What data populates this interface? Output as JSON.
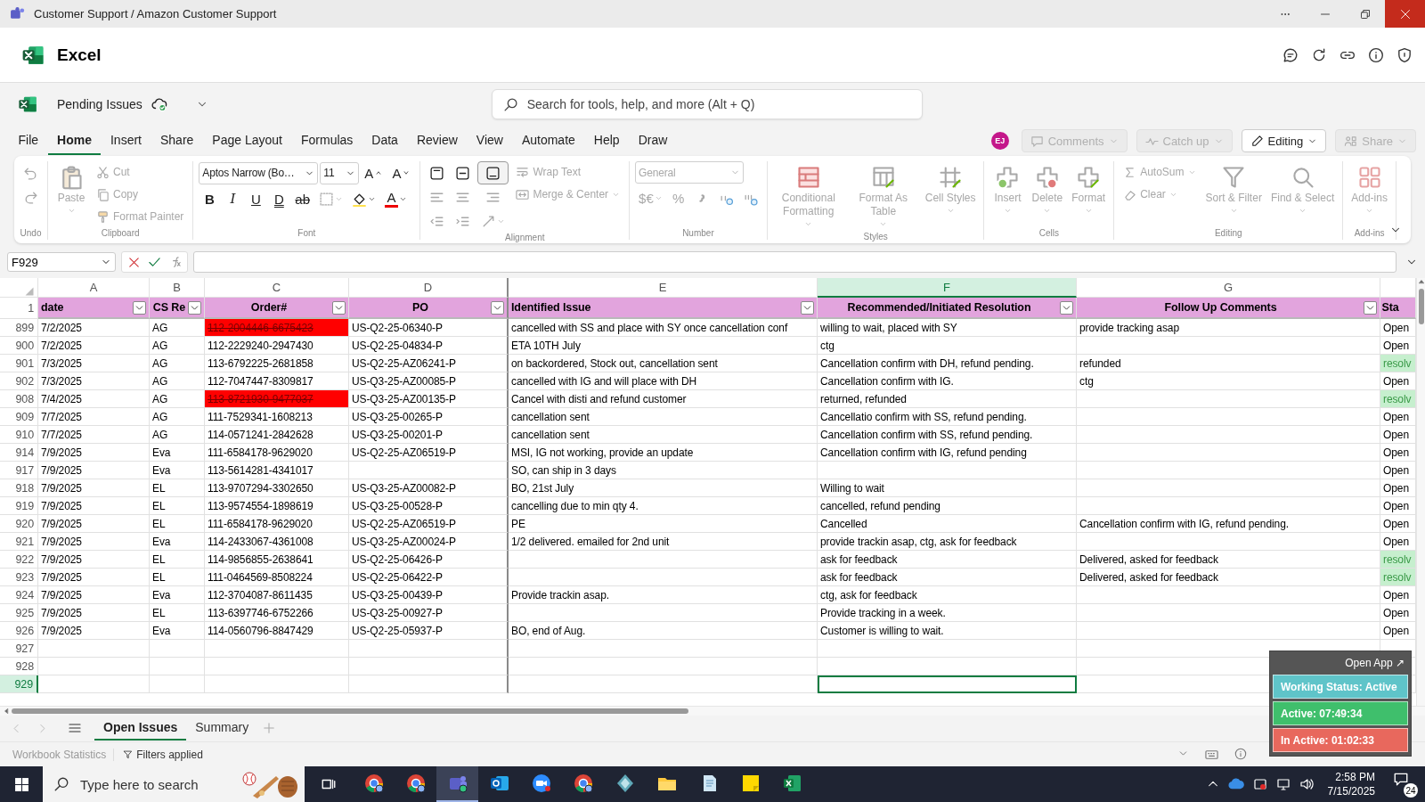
{
  "window": {
    "title": "Customer Support / Amazon Customer Support"
  },
  "app": {
    "name": "Excel"
  },
  "document": {
    "name": "Pending Issues"
  },
  "search": {
    "placeholder": "Search for tools, help, and more (Alt + Q)"
  },
  "menu_tabs": [
    {
      "label": "File",
      "selected": false
    },
    {
      "label": "Home",
      "selected": true
    },
    {
      "label": "Insert",
      "selected": false
    },
    {
      "label": "Share",
      "selected": false
    },
    {
      "label": "Page Layout",
      "selected": false
    },
    {
      "label": "Formulas",
      "selected": false
    },
    {
      "label": "Data",
      "selected": false
    },
    {
      "label": "Review",
      "selected": false
    },
    {
      "label": "View",
      "selected": false
    },
    {
      "label": "Automate",
      "selected": false
    },
    {
      "label": "Help",
      "selected": false
    },
    {
      "label": "Draw",
      "selected": false
    }
  ],
  "user": {
    "initials": "EJ"
  },
  "actions": [
    {
      "label": "Comments",
      "disabled": true
    },
    {
      "label": "Catch up",
      "disabled": true
    },
    {
      "label": "Editing",
      "disabled": false
    },
    {
      "label": "Share",
      "disabled": true
    }
  ],
  "ribbon": {
    "groups": [
      {
        "label": "Undo",
        "columns": [
          [
            {
              "kind": "tool",
              "disabled": true
            },
            {
              "kind": "tool",
              "disabled": true
            }
          ]
        ]
      },
      {
        "label": "Clipboard",
        "columns": [
          [
            {
              "kind": "large",
              "label": "Paste",
              "disabled": true,
              "dropdown": true
            }
          ],
          [
            {
              "kind": "small",
              "label": "Cut",
              "disabled": true
            },
            {
              "kind": "small",
              "label": "Copy",
              "disabled": true
            },
            {
              "kind": "small",
              "label": "Format Painter",
              "disabled": true
            }
          ]
        ]
      },
      {
        "label": "Font",
        "lines": [
          [
            {
              "kind": "select",
              "value": "Aptos Narrow (Bo…",
              "disabled": false
            },
            {
              "kind": "select",
              "value": "11",
              "disabled": false
            },
            {
              "kind": "tool",
              "label": "A",
              "disabled": false
            },
            {
              "kind": "tool",
              "label": "A",
              "disabled": false
            }
          ],
          [
            {
              "kind": "tool",
              "label": "B",
              "disabled": false
            },
            {
              "kind": "tool",
              "label": "I",
              "disabled": false
            },
            {
              "kind": "tool",
              "label": "U",
              "disabled": false
            },
            {
              "kind": "tool",
              "label": "D",
              "disabled": false
            },
            {
              "kind": "tool",
              "label": "ab",
              "disabled": false
            },
            {
              "kind": "tool",
              "disabled": true,
              "dropdown": true
            },
            {
              "kind": "tool",
              "disabled": false,
              "dropdown": true
            },
            {
              "kind": "tool",
              "label": "A",
              "disabled": false,
              "dropdown": true
            }
          ]
        ]
      },
      {
        "label": "Alignment",
        "columns": [
          [
            {
              "kind": "tool",
              "disabled": false,
              "selected": false
            },
            {
              "kind": "tool",
              "disabled": true
            },
            {
              "kind": "tool",
              "disabled": true
            }
          ],
          [
            {
              "kind": "tool",
              "disabled": false,
              "selected": false
            },
            {
              "kind": "tool",
              "disabled": true
            },
            {
              "kind": "tool",
              "disabled": true
            }
          ],
          [
            {
              "kind": "tool",
              "disabled": false,
              "selected": true
            },
            {
              "kind": "tool",
              "disabled": true
            },
            {
              "kind": "tool",
              "disabled": true,
              "dropdown": true
            }
          ],
          [
            {
              "kind": "small",
              "label": "Wrap Text",
              "disabled": true
            },
            {
              "kind": "small",
              "label": "Merge & Center",
              "disabled": true,
              "dropdown": true
            }
          ]
        ]
      },
      {
        "label": "Number",
        "lines": [
          [
            {
              "kind": "select",
              "value": "General",
              "disabled": true
            }
          ],
          [
            {
              "kind": "tool",
              "label": "$€",
              "disabled": true,
              "dropdown": true
            },
            {
              "kind": "tool",
              "label": "%",
              "disabled": true
            },
            {
              "kind": "tool",
              "disabled": true
            },
            {
              "kind": "tool",
              "disabled": true
            },
            {
              "kind": "tool",
              "disabled": true
            }
          ]
        ]
      },
      {
        "label": "Styles",
        "columns": [
          [
            {
              "kind": "large",
              "label": "Conditional Formatting",
              "disabled": true,
              "dropdown": true
            }
          ],
          [
            {
              "kind": "large",
              "label": "Format As Table",
              "disabled": true,
              "dropdown": true
            }
          ],
          [
            {
              "kind": "large",
              "label": "Cell Styles",
              "disabled": true,
              "dropdown": true
            }
          ]
        ]
      },
      {
        "label": "Cells",
        "columns": [
          [
            {
              "kind": "large",
              "label": "Insert",
              "disabled": true,
              "dropdown": true
            }
          ],
          [
            {
              "kind": "large",
              "label": "Delete",
              "disabled": true,
              "dropdown": true
            }
          ],
          [
            {
              "kind": "large",
              "label": "Format",
              "disabled": true,
              "dropdown": true
            }
          ]
        ]
      },
      {
        "label": "Editing",
        "columns": [
          [
            {
              "kind": "small",
              "label": "AutoSum",
              "disabled": true,
              "dropdown": true
            },
            {
              "kind": "small",
              "label": "Clear",
              "disabled": true,
              "dropdown": true
            }
          ],
          [
            {
              "kind": "large",
              "label": "Sort & Filter",
              "disabled": true,
              "dropdown": true
            }
          ],
          [
            {
              "kind": "large",
              "label": "Find & Select",
              "disabled": true,
              "dropdown": true
            }
          ]
        ]
      },
      {
        "label": "Add-ins",
        "columns": [
          [
            {
              "kind": "large",
              "label": "Add-ins",
              "disabled": true,
              "dropdown": true
            }
          ]
        ]
      }
    ]
  },
  "formula_bar": {
    "name_box": "F929"
  },
  "sheet": {
    "columns": [
      {
        "letter": "A",
        "selected": false
      },
      {
        "letter": "B",
        "selected": false
      },
      {
        "letter": "C",
        "selected": false
      },
      {
        "letter": "D",
        "selected": false
      },
      {
        "letter": "E",
        "selected": false
      },
      {
        "letter": "F",
        "selected": true
      },
      {
        "letter": "G",
        "selected": false
      }
    ],
    "header_row": "1",
    "headers": [
      "date",
      "CS Re",
      "Order#",
      "PO",
      "Identified Issue",
      "Recommended/Initiated Resolution",
      "Follow Up Comments",
      "Sta"
    ],
    "rows": [
      {
        "row": "899",
        "selected": false,
        "date": "7/2/2025",
        "cs_rep": "AG",
        "order": "112-2004446-6675423",
        "order_flagged": true,
        "po": "US-Q2-25-06340-P",
        "issue": "cancelled with SS and place with SY once cancellation conf",
        "resolution": "willing to wait, placed with SY",
        "follow_up": "provide tracking asap",
        "status": "Open",
        "resolved": false
      },
      {
        "row": "900",
        "selected": false,
        "date": "7/2/2025",
        "cs_rep": "AG",
        "order": "112-2229240-2947430",
        "order_flagged": false,
        "po": "US-Q2-25-04834-P",
        "issue": "ETA 10TH July",
        "resolution": "ctg",
        "status": "Open",
        "resolved": false
      },
      {
        "row": "901",
        "selected": false,
        "date": "7/3/2025",
        "cs_rep": "AG",
        "order": "113-6792225-2681858",
        "order_flagged": false,
        "po": "US-Q2-25-AZ06241-P",
        "issue": "on backordered, Stock out, cancellation sent",
        "resolution": "Cancellation confirm with DH, refund pending.",
        "follow_up": "refunded",
        "status": "resolv",
        "resolved": true
      },
      {
        "row": "902",
        "selected": false,
        "date": "7/3/2025",
        "cs_rep": "AG",
        "order": "112-7047447-8309817",
        "order_flagged": false,
        "po": "US-Q3-25-AZ00085-P",
        "issue": "cancelled with IG and will place with DH",
        "resolution": "Cancellation confirm with IG.",
        "follow_up": "ctg",
        "status": "Open",
        "resolved": false
      },
      {
        "row": "908",
        "selected": false,
        "date": "7/4/2025",
        "cs_rep": "AG",
        "order": "113-8721930-9477037",
        "order_flagged": true,
        "po": "US-Q3-25-AZ00135-P",
        "issue": "Cancel with disti and refund customer",
        "resolution": "returned, refunded",
        "status": "resolv",
        "resolved": true
      },
      {
        "row": "909",
        "selected": false,
        "date": "7/7/2025",
        "cs_rep": "AG",
        "order": "111-7529341-1608213",
        "order_flagged": false,
        "po": "US-Q3-25-00265-P",
        "issue": "cancellation sent",
        "resolution": "Cancellatio confirm with SS, refund pending.",
        "status": "Open",
        "resolved": false
      },
      {
        "row": "910",
        "selected": false,
        "date": "7/7/2025",
        "cs_rep": "AG",
        "order": "114-0571241-2842628",
        "order_flagged": false,
        "po": "US-Q3-25-00201-P",
        "issue": "cancellation sent",
        "resolution": "Cancellation confirm with SS, refund pending.",
        "status": "Open",
        "resolved": false
      },
      {
        "row": "914",
        "selected": false,
        "date": "7/9/2025",
        "cs_rep": "Eva",
        "order": "111-6584178-9629020",
        "order_flagged": false,
        "po": "US-Q2-25-AZ06519-P",
        "issue": "MSI, IG not working, provide an update",
        "resolution": "Cancellation confirm with IG, refund pending",
        "status": "Open",
        "resolved": false
      },
      {
        "row": "917",
        "selected": false,
        "date": "7/9/2025",
        "cs_rep": "Eva",
        "order": "113-5614281-4341017",
        "order_flagged": false,
        "issue": "SO, can ship in 3 days",
        "status": "Open",
        "resolved": false
      },
      {
        "row": "918",
        "selected": false,
        "date": "7/9/2025",
        "cs_rep": "EL",
        "order": "113-9707294-3302650",
        "order_flagged": false,
        "po": "US-Q3-25-AZ00082-P",
        "issue": "BO, 21st July",
        "resolution": "Willing to wait",
        "status": "Open",
        "resolved": false
      },
      {
        "row": "919",
        "selected": false,
        "date": "7/9/2025",
        "cs_rep": "EL",
        "order": "113-9574554-1898619",
        "order_flagged": false,
        "po": "US-Q3-25-00528-P",
        "issue": "cancelling due to min qty 4.",
        "resolution": "cancelled, refund pending",
        "status": "Open",
        "resolved": false
      },
      {
        "row": "920",
        "selected": false,
        "date": "7/9/2025",
        "cs_rep": "EL",
        "order": "111-6584178-9629020",
        "order_flagged": false,
        "po": "US-Q2-25-AZ06519-P",
        "issue": "PE",
        "resolution": "Cancelled",
        "follow_up": "Cancellation confirm with IG, refund pending.",
        "status": "Open",
        "resolved": false
      },
      {
        "row": "921",
        "selected": false,
        "date": "7/9/2025",
        "cs_rep": "Eva",
        "order": "114-2433067-4361008",
        "order_flagged": false,
        "po": "US-Q3-25-AZ00024-P",
        "issue": "1/2 delivered. emailed for 2nd unit",
        "resolution": "provide trackin asap, ctg, ask for feedback",
        "status": "Open",
        "resolved": false
      },
      {
        "row": "922",
        "selected": false,
        "date": "7/9/2025",
        "cs_rep": "EL",
        "order": "114-9856855-2638641",
        "order_flagged": false,
        "po": "US-Q2-25-06426-P",
        "resolution": "ask for feedback",
        "follow_up": "Delivered, asked for feedback",
        "status": "resolv",
        "resolved": true
      },
      {
        "row": "923",
        "selected": false,
        "date": "7/9/2025",
        "cs_rep": "EL",
        "order": "111-0464569-8508224",
        "order_flagged": false,
        "po": "US-Q2-25-06422-P",
        "resolution": "ask for feedback",
        "follow_up": "Delivered, asked for feedback",
        "status": "resolv",
        "resolved": true
      },
      {
        "row": "924",
        "selected": false,
        "date": "7/9/2025",
        "cs_rep": "Eva",
        "order": "112-3704087-8611435",
        "order_flagged": false,
        "po": "US-Q3-25-00439-P",
        "issue": "Provide trackin asap.",
        "resolution": "ctg, ask for feedback",
        "status": "Open",
        "resolved": false
      },
      {
        "row": "925",
        "selected": false,
        "date": "7/9/2025",
        "cs_rep": "EL",
        "order": "113-6397746-6752266",
        "order_flagged": false,
        "po": "US-Q3-25-00927-P",
        "resolution": "Provide tracking in a week.",
        "status": "Open",
        "resolved": false
      },
      {
        "row": "926",
        "selected": false,
        "date": "7/9/2025",
        "cs_rep": "Eva",
        "order": "114-0560796-8847429",
        "order_flagged": false,
        "po": "US-Q2-25-05937-P",
        "issue": "BO, end of Aug.",
        "resolution": "Customer is willing to wait.",
        "status": "Open",
        "resolved": false
      },
      {
        "row": "927",
        "selected": false
      },
      {
        "row": "928",
        "selected": false
      },
      {
        "row": "929",
        "selected": true
      }
    ]
  },
  "sheet_tabs": [
    {
      "label": "Open Issues",
      "selected": true
    },
    {
      "label": "Summary",
      "selected": false
    }
  ],
  "status_bar": [
    {
      "label": "Workbook Statistics",
      "disabled": true
    },
    {
      "label": "Filters applied",
      "disabled": false
    }
  ],
  "tracker": {
    "link": "Open App ↗",
    "items": [
      {
        "label": "Working Status: Active",
        "color": "#5fc4c9"
      },
      {
        "label": "Active: 07:49:34",
        "color": "#3fbf6c"
      },
      {
        "label": "In Active: 01:02:33",
        "color": "#e8685d"
      }
    ]
  },
  "taskbar": {
    "search_placeholder": "Type here to search",
    "apps": [
      {
        "kind": "chrome",
        "selected": false
      },
      {
        "kind": "chrome",
        "selected": false
      },
      {
        "kind": "teams",
        "selected": true
      },
      {
        "kind": "outlook",
        "selected": false
      },
      {
        "kind": "zoom",
        "selected": false
      },
      {
        "kind": "chrome",
        "selected": false
      },
      {
        "kind": "diamond",
        "selected": false
      },
      {
        "kind": "folder",
        "selected": false
      },
      {
        "kind": "notepad",
        "selected": false
      },
      {
        "kind": "sticky",
        "selected": false
      },
      {
        "kind": "excel",
        "selected": false
      }
    ],
    "time": "2:58 PM",
    "date": "7/15/2025",
    "notifications": "24"
  }
}
